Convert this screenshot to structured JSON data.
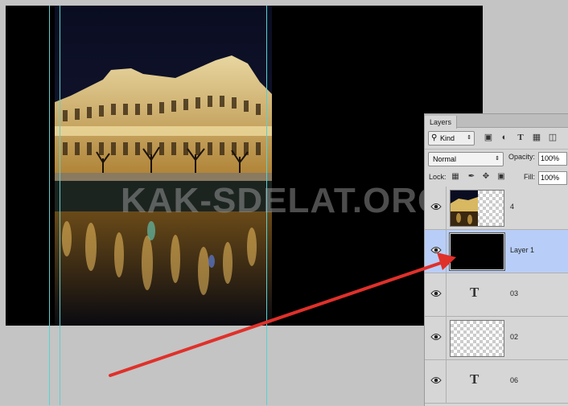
{
  "watermark": "KAK-SDELAT.ORG",
  "layers_panel": {
    "tab": "Layers",
    "filter_kind": "Kind",
    "blend_mode": "Normal",
    "opacity_label": "Opacity:",
    "opacity_value": "100%",
    "lock_label": "Lock:",
    "fill_label": "Fill:",
    "fill_value": "100%",
    "layers": [
      {
        "name": "4",
        "thumb": "photo",
        "selected": false
      },
      {
        "name": "Layer 1",
        "thumb": "black",
        "selected": true
      },
      {
        "name": "03",
        "thumb": "text",
        "selected": false
      },
      {
        "name": "02",
        "thumb": "transparent",
        "selected": false
      },
      {
        "name": "06",
        "thumb": "text",
        "selected": false
      }
    ]
  },
  "colors": {
    "selected_layer": "#b8cef8",
    "guide": "#5ad0d0",
    "arrow": "#e0302a"
  },
  "icons": [
    "search-icon",
    "image-filter-icon",
    "adjustment-filter-icon",
    "type-filter-icon",
    "shape-filter-icon",
    "smart-object-filter-icon",
    "lock-transparent-icon",
    "lock-paint-icon",
    "lock-move-icon",
    "lock-all-icon",
    "eye-icon"
  ]
}
